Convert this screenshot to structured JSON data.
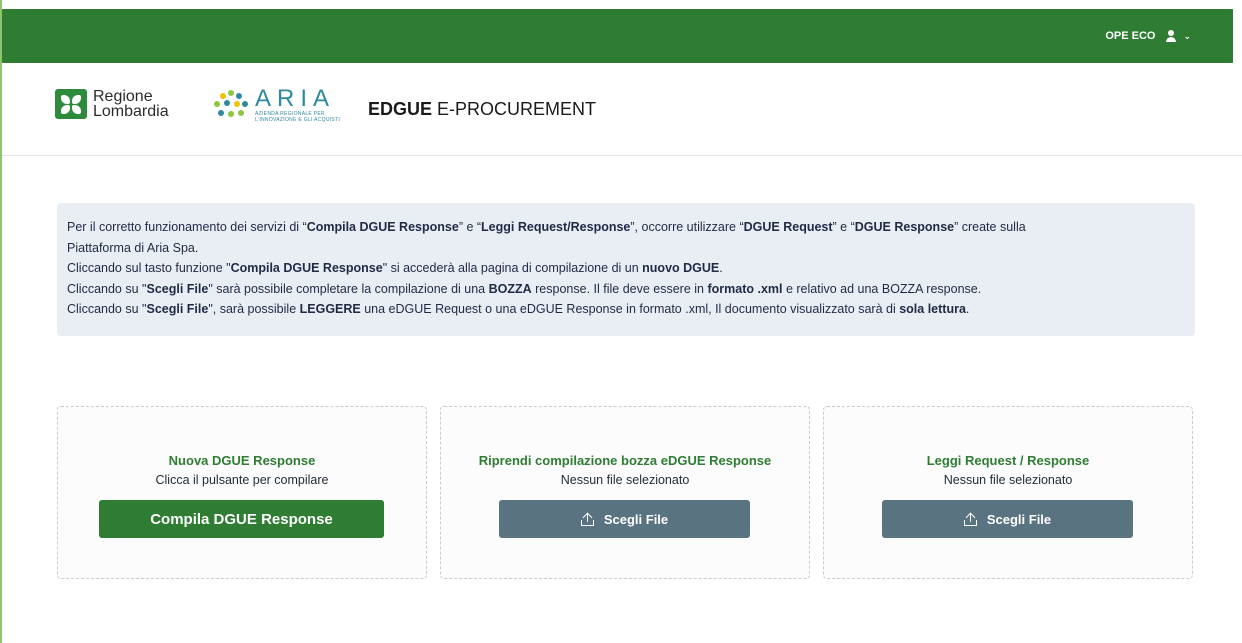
{
  "topbar": {
    "username": "OPE ECO"
  },
  "header": {
    "regione_line1": "Regione",
    "regione_line2": "Lombardia",
    "aria_name": "ARIA",
    "aria_tag1": "AZIENDA REGIONALE PER",
    "aria_tag2": "L'INNOVAZIONE E GLI ACQUISTI",
    "app_title_bold": "EDGUE",
    "app_title_rest": "E-PROCUREMENT"
  },
  "info": {
    "l1a": "Per il corretto funzionamento dei servizi di “",
    "l1b": "Compila DGUE Response",
    "l1c": "” e “",
    "l1d": "Leggi Request/Response",
    "l1e": "”, occorre utilizzare “",
    "l1f": "DGUE Request",
    "l1g": "” e “",
    "l1h": "DGUE Response",
    "l1i": "” create sulla",
    "l2": "Piattaforma di Aria Spa.",
    "l3a": "Cliccando sul tasto funzione \"",
    "l3b": "Compila DGUE Response",
    "l3c": "\" si accederà alla pagina di compilazione di un ",
    "l3d": "nuovo DGUE",
    "l3e": ".",
    "l4a": "Cliccando su \"",
    "l4b": "Scegli File",
    "l4c": "\" sarà possibile completare la compilazione di una ",
    "l4d": "BOZZA",
    "l4e": " response. Il file deve essere in ",
    "l4f": "formato .xml",
    "l4g": " e relativo ad una BOZZA response.",
    "l5a": "Cliccando su \"",
    "l5b": "Scegli File",
    "l5c": "\", sarà possibile ",
    "l5d": "LEGGERE",
    "l5e": " una eDGUE Request o una eDGUE Response in formato .xml, Il documento visualizzato sarà di ",
    "l5f": "sola lettura",
    "l5g": "."
  },
  "cards": [
    {
      "title": "Nuova DGUE Response",
      "subtitle": "Clicca il pulsante per compilare",
      "button": "Compila DGUE Response"
    },
    {
      "title": "Riprendi compilazione bozza eDGUE Response",
      "subtitle": "Nessun file selezionato",
      "button": "Scegli File"
    },
    {
      "title": "Leggi Request / Response",
      "subtitle": "Nessun file selezionato",
      "button": "Scegli File"
    }
  ],
  "colors": {
    "primary": "#2e7d32",
    "slate": "#5a7381",
    "info_bg": "#e9edf4"
  },
  "icons": {
    "user": "user-icon",
    "chevron": "chevron-down-icon",
    "upload": "upload-icon"
  }
}
